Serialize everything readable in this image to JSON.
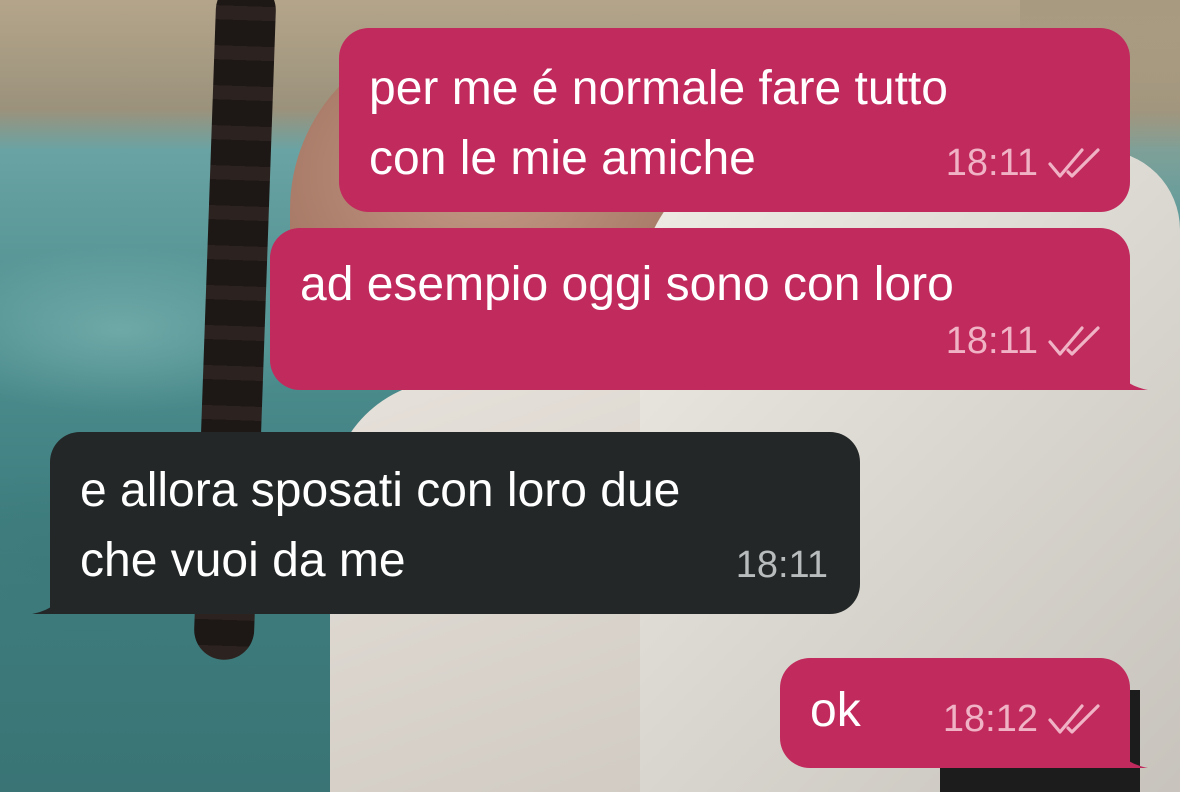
{
  "messages": [
    {
      "direction": "outgoing",
      "text": "per me é normale fare tutto\ncon le mie amiche",
      "time": "18:11",
      "status_icon": "double-check-icon"
    },
    {
      "direction": "outgoing",
      "text": "ad esempio oggi sono con loro",
      "time": "18:11",
      "status_icon": "double-check-icon"
    },
    {
      "direction": "incoming",
      "text": "e allora sposati con loro due\nche vuoi da me",
      "time": "18:11"
    },
    {
      "direction": "outgoing",
      "text": "ok",
      "time": "18:12",
      "status_icon": "double-check-icon"
    }
  ],
  "colors": {
    "outgoing_bubble": "#c12a5d",
    "incoming_bubble": "#232727",
    "outgoing_meta": "#f0b3c6",
    "incoming_meta": "#b9bcbc"
  }
}
